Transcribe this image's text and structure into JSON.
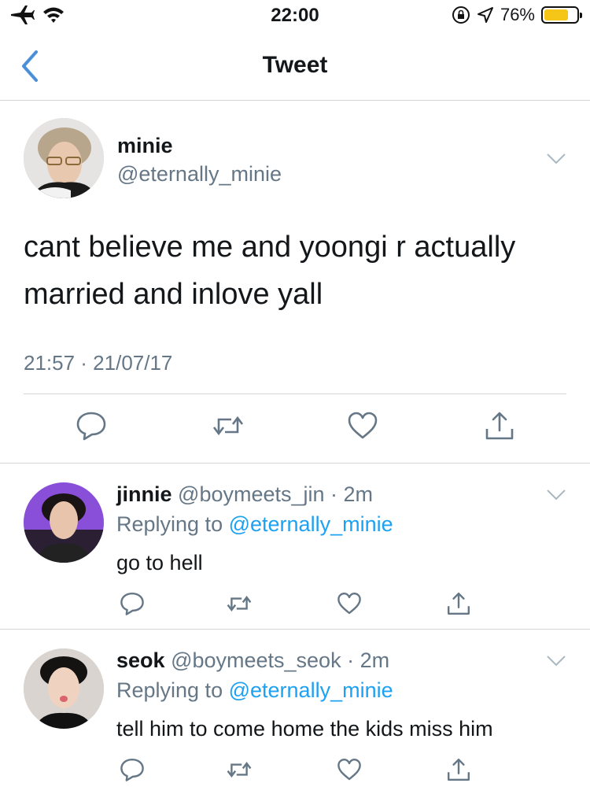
{
  "status_bar": {
    "time": "22:00",
    "battery_percent": "76%",
    "battery_level": 0.76
  },
  "nav": {
    "title": "Tweet"
  },
  "main_tweet": {
    "name": "minie",
    "handle": "@eternally_minie",
    "text": "cant believe me and yoongi r actually married and inlove yall",
    "timestamp": "21:57 · 21/07/17"
  },
  "replies": [
    {
      "name": "jinnie",
      "handle": "@boymeets_jin · 2m",
      "replying_label": "Replying to",
      "replying_to": "@eternally_minie",
      "text": "go to hell"
    },
    {
      "name": "seok",
      "handle": "@boymeets_seok · 2m",
      "replying_label": "Replying to",
      "replying_to": "@eternally_minie",
      "text": "tell him to come home the kids miss him"
    }
  ],
  "colors": {
    "accent": "#1da1f2",
    "muted": "#657786",
    "text": "#14171a",
    "back": "#4a90d9"
  }
}
